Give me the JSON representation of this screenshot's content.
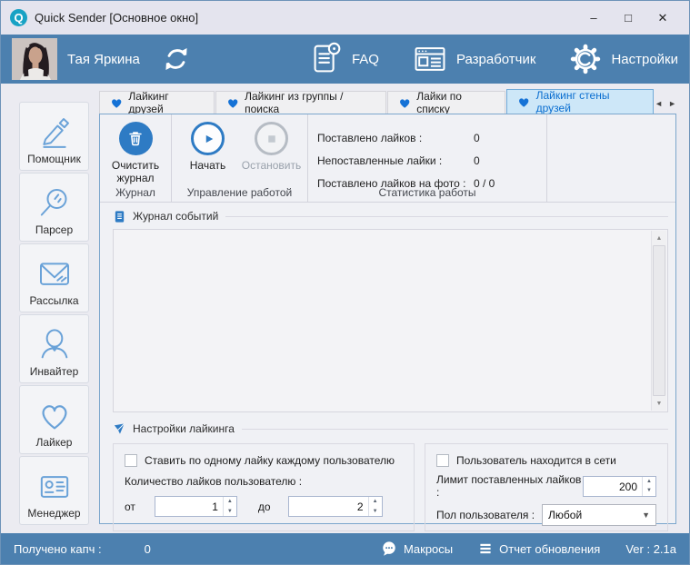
{
  "window": {
    "title": "Quick Sender [Основное окно]",
    "logo_letter": "Q",
    "minimize": "–",
    "maximize": "□",
    "close": "✕"
  },
  "header": {
    "user_name": "Тая Яркина",
    "faq_label": "FAQ",
    "developer_label": "Разработчик",
    "settings_label": "Настройки"
  },
  "sidebar": {
    "items": [
      {
        "label": "Помощник",
        "icon": "pencil-icon"
      },
      {
        "label": "Парсер",
        "icon": "magnifier-icon"
      },
      {
        "label": "Рассылка",
        "icon": "envelope-icon"
      },
      {
        "label": "Инвайтер",
        "icon": "person-icon"
      },
      {
        "label": "Лайкер",
        "icon": "heart-icon"
      },
      {
        "label": "Менеджер",
        "icon": "id-card-icon"
      }
    ]
  },
  "tabs": {
    "items": [
      {
        "label": "Лайкинг друзей",
        "active": false
      },
      {
        "label": "Лайкинг из группы / поиска",
        "active": false
      },
      {
        "label": "Лайки по списку",
        "active": false
      },
      {
        "label": "Лайкинг стены друзей",
        "active": true
      }
    ],
    "scroll_left": "◄",
    "scroll_right": "►"
  },
  "toolbar": {
    "clear_log_label": "Очистить журнал",
    "journal_caption": "Журнал",
    "start_label": "Начать",
    "stop_label": "Остановить",
    "control_caption": "Управление работой",
    "stats": [
      {
        "label": "Поставлено лайков :",
        "value": "0"
      },
      {
        "label": "Непоставленные лайки :",
        "value": "0"
      },
      {
        "label": "Поставлено лайков на фото :",
        "value": "0 / 0"
      }
    ],
    "stats_caption": "Статистика работы"
  },
  "log": {
    "title": "Журнал событий",
    "content": ""
  },
  "settings": {
    "title": "Настройки лайкинга",
    "left": {
      "checkbox_label": "Ставить по одному лайку каждому пользователю",
      "checked": false,
      "count_label": "Количество лайков пользователю :",
      "from_label": "от",
      "from_value": "1",
      "to_label": "до",
      "to_value": "2"
    },
    "right": {
      "checkbox_label": "Пользователь находится в сети",
      "checked": false,
      "limit_label": "Лимит поставленных лайков :",
      "limit_value": "200",
      "gender_label": "Пол пользователя :",
      "gender_value": "Любой"
    }
  },
  "statusbar": {
    "captcha_label": "Получено капч :",
    "captcha_value": "0",
    "macros_label": "Макросы",
    "update_label": "Отчет обновления",
    "version": "Ver : 2.1a"
  },
  "colors": {
    "header_blue": "#4c80af",
    "accent_blue": "#2e7bc4",
    "heart_blue": "#1572d6",
    "active_tab_bg": "#cde7f8",
    "icon_stroke_blue": "#6aa2d8",
    "logo_teal": "#17a2c4"
  }
}
